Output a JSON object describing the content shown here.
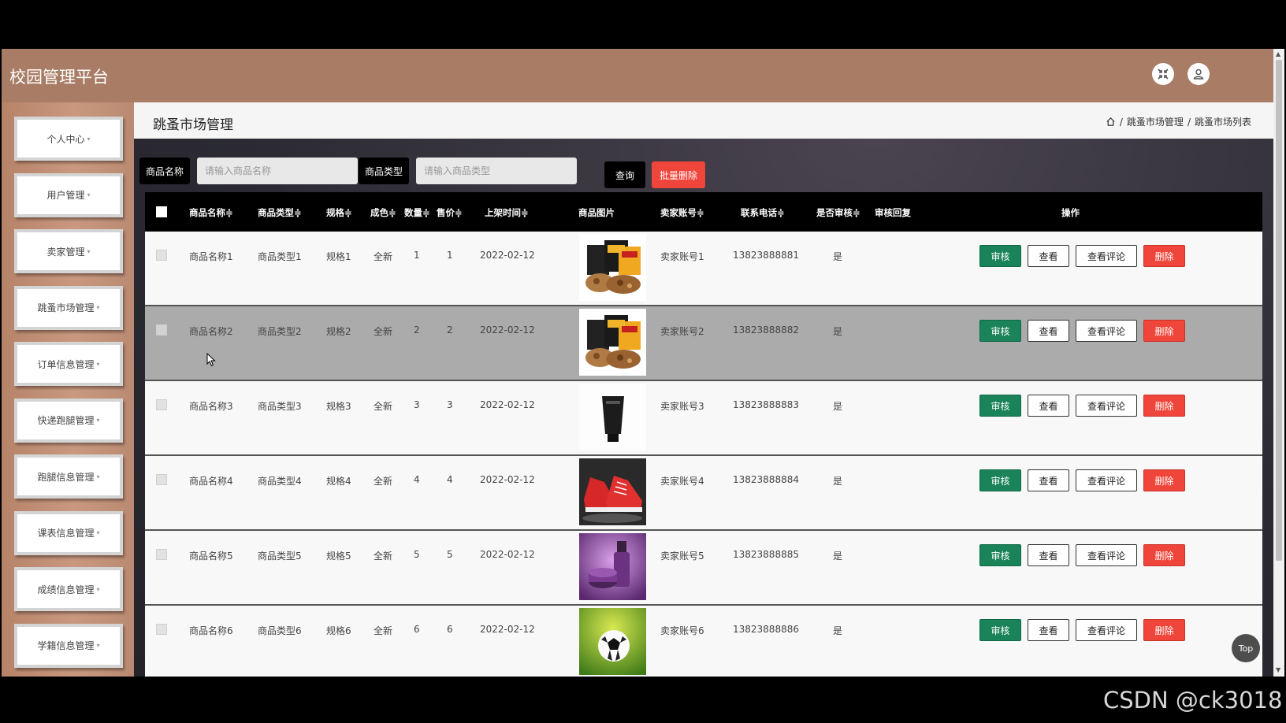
{
  "app": {
    "title": "校园管理平台"
  },
  "sidebar": {
    "items": [
      {
        "label": "个人中心"
      },
      {
        "label": "用户管理"
      },
      {
        "label": "卖家管理"
      },
      {
        "label": "跳蚤市场管理"
      },
      {
        "label": "订单信息管理"
      },
      {
        "label": "快递跑腿管理"
      },
      {
        "label": "跑腿信息管理"
      },
      {
        "label": "课表信息管理"
      },
      {
        "label": "成绩信息管理"
      },
      {
        "label": "学籍信息管理"
      }
    ],
    "caret": "▾"
  },
  "page": {
    "title": "跳蚤市场管理",
    "breadcrumb": [
      "跳蚤市场管理",
      "跳蚤市场列表"
    ],
    "breadcrumb_sep": "/"
  },
  "search": {
    "name_label": "商品名称",
    "name_placeholder": "请输入商品名称",
    "type_label": "商品类型",
    "type_placeholder": "请输入商品类型",
    "query_button": "查询",
    "batch_delete_button": "批量删除"
  },
  "table": {
    "headers": [
      "商品名称≑",
      "商品类型≑",
      "规格≑",
      "成色≑",
      "数量≑",
      "售价≑",
      "上架时间≑",
      "商品图片",
      "卖家账号≑",
      "联系电话≑",
      "是否审核≑",
      "审核回复",
      "操作"
    ],
    "actions": {
      "audit": "审核",
      "view": "查看",
      "comment": "查看评论",
      "delete": "删除"
    },
    "rows": [
      {
        "name": "商品名称1",
        "type": "商品类型1",
        "spec": "规格1",
        "condition": "全新",
        "qty": "1",
        "price": "1",
        "date": "2022-02-12",
        "image": "snack-bags",
        "seller": "卖家账号1",
        "phone": "13823888881",
        "audited": "是",
        "reply": ""
      },
      {
        "name": "商品名称2",
        "type": "商品类型2",
        "spec": "规格2",
        "condition": "全新",
        "qty": "2",
        "price": "2",
        "date": "2022-02-12",
        "image": "snack-bags",
        "seller": "卖家账号2",
        "phone": "13823888882",
        "audited": "是",
        "reply": ""
      },
      {
        "name": "商品名称3",
        "type": "商品类型3",
        "spec": "规格3",
        "condition": "全新",
        "qty": "3",
        "price": "3",
        "date": "2022-02-12",
        "image": "cleanser-tube",
        "seller": "卖家账号3",
        "phone": "13823888883",
        "audited": "是",
        "reply": ""
      },
      {
        "name": "商品名称4",
        "type": "商品类型4",
        "spec": "规格4",
        "condition": "全新",
        "qty": "4",
        "price": "4",
        "date": "2022-02-12",
        "image": "red-sneakers",
        "seller": "卖家账号4",
        "phone": "13823888884",
        "audited": "是",
        "reply": ""
      },
      {
        "name": "商品名称5",
        "type": "商品类型5",
        "spec": "规格5",
        "condition": "全新",
        "qty": "5",
        "price": "5",
        "date": "2022-02-12",
        "image": "cosmetics-purple",
        "seller": "卖家账号5",
        "phone": "13823888885",
        "audited": "是",
        "reply": ""
      },
      {
        "name": "商品名称6",
        "type": "商品类型6",
        "spec": "规格6",
        "condition": "全新",
        "qty": "6",
        "price": "6",
        "date": "2022-02-12",
        "image": "soccer-ball",
        "seller": "卖家账号6",
        "phone": "13823888886",
        "audited": "是",
        "reply": ""
      }
    ]
  },
  "top_button": "Top",
  "watermark": "CSDN @ck3018",
  "colors": {
    "header": "#a97c65",
    "audit": "#1a8359",
    "delete": "#f0453a"
  }
}
